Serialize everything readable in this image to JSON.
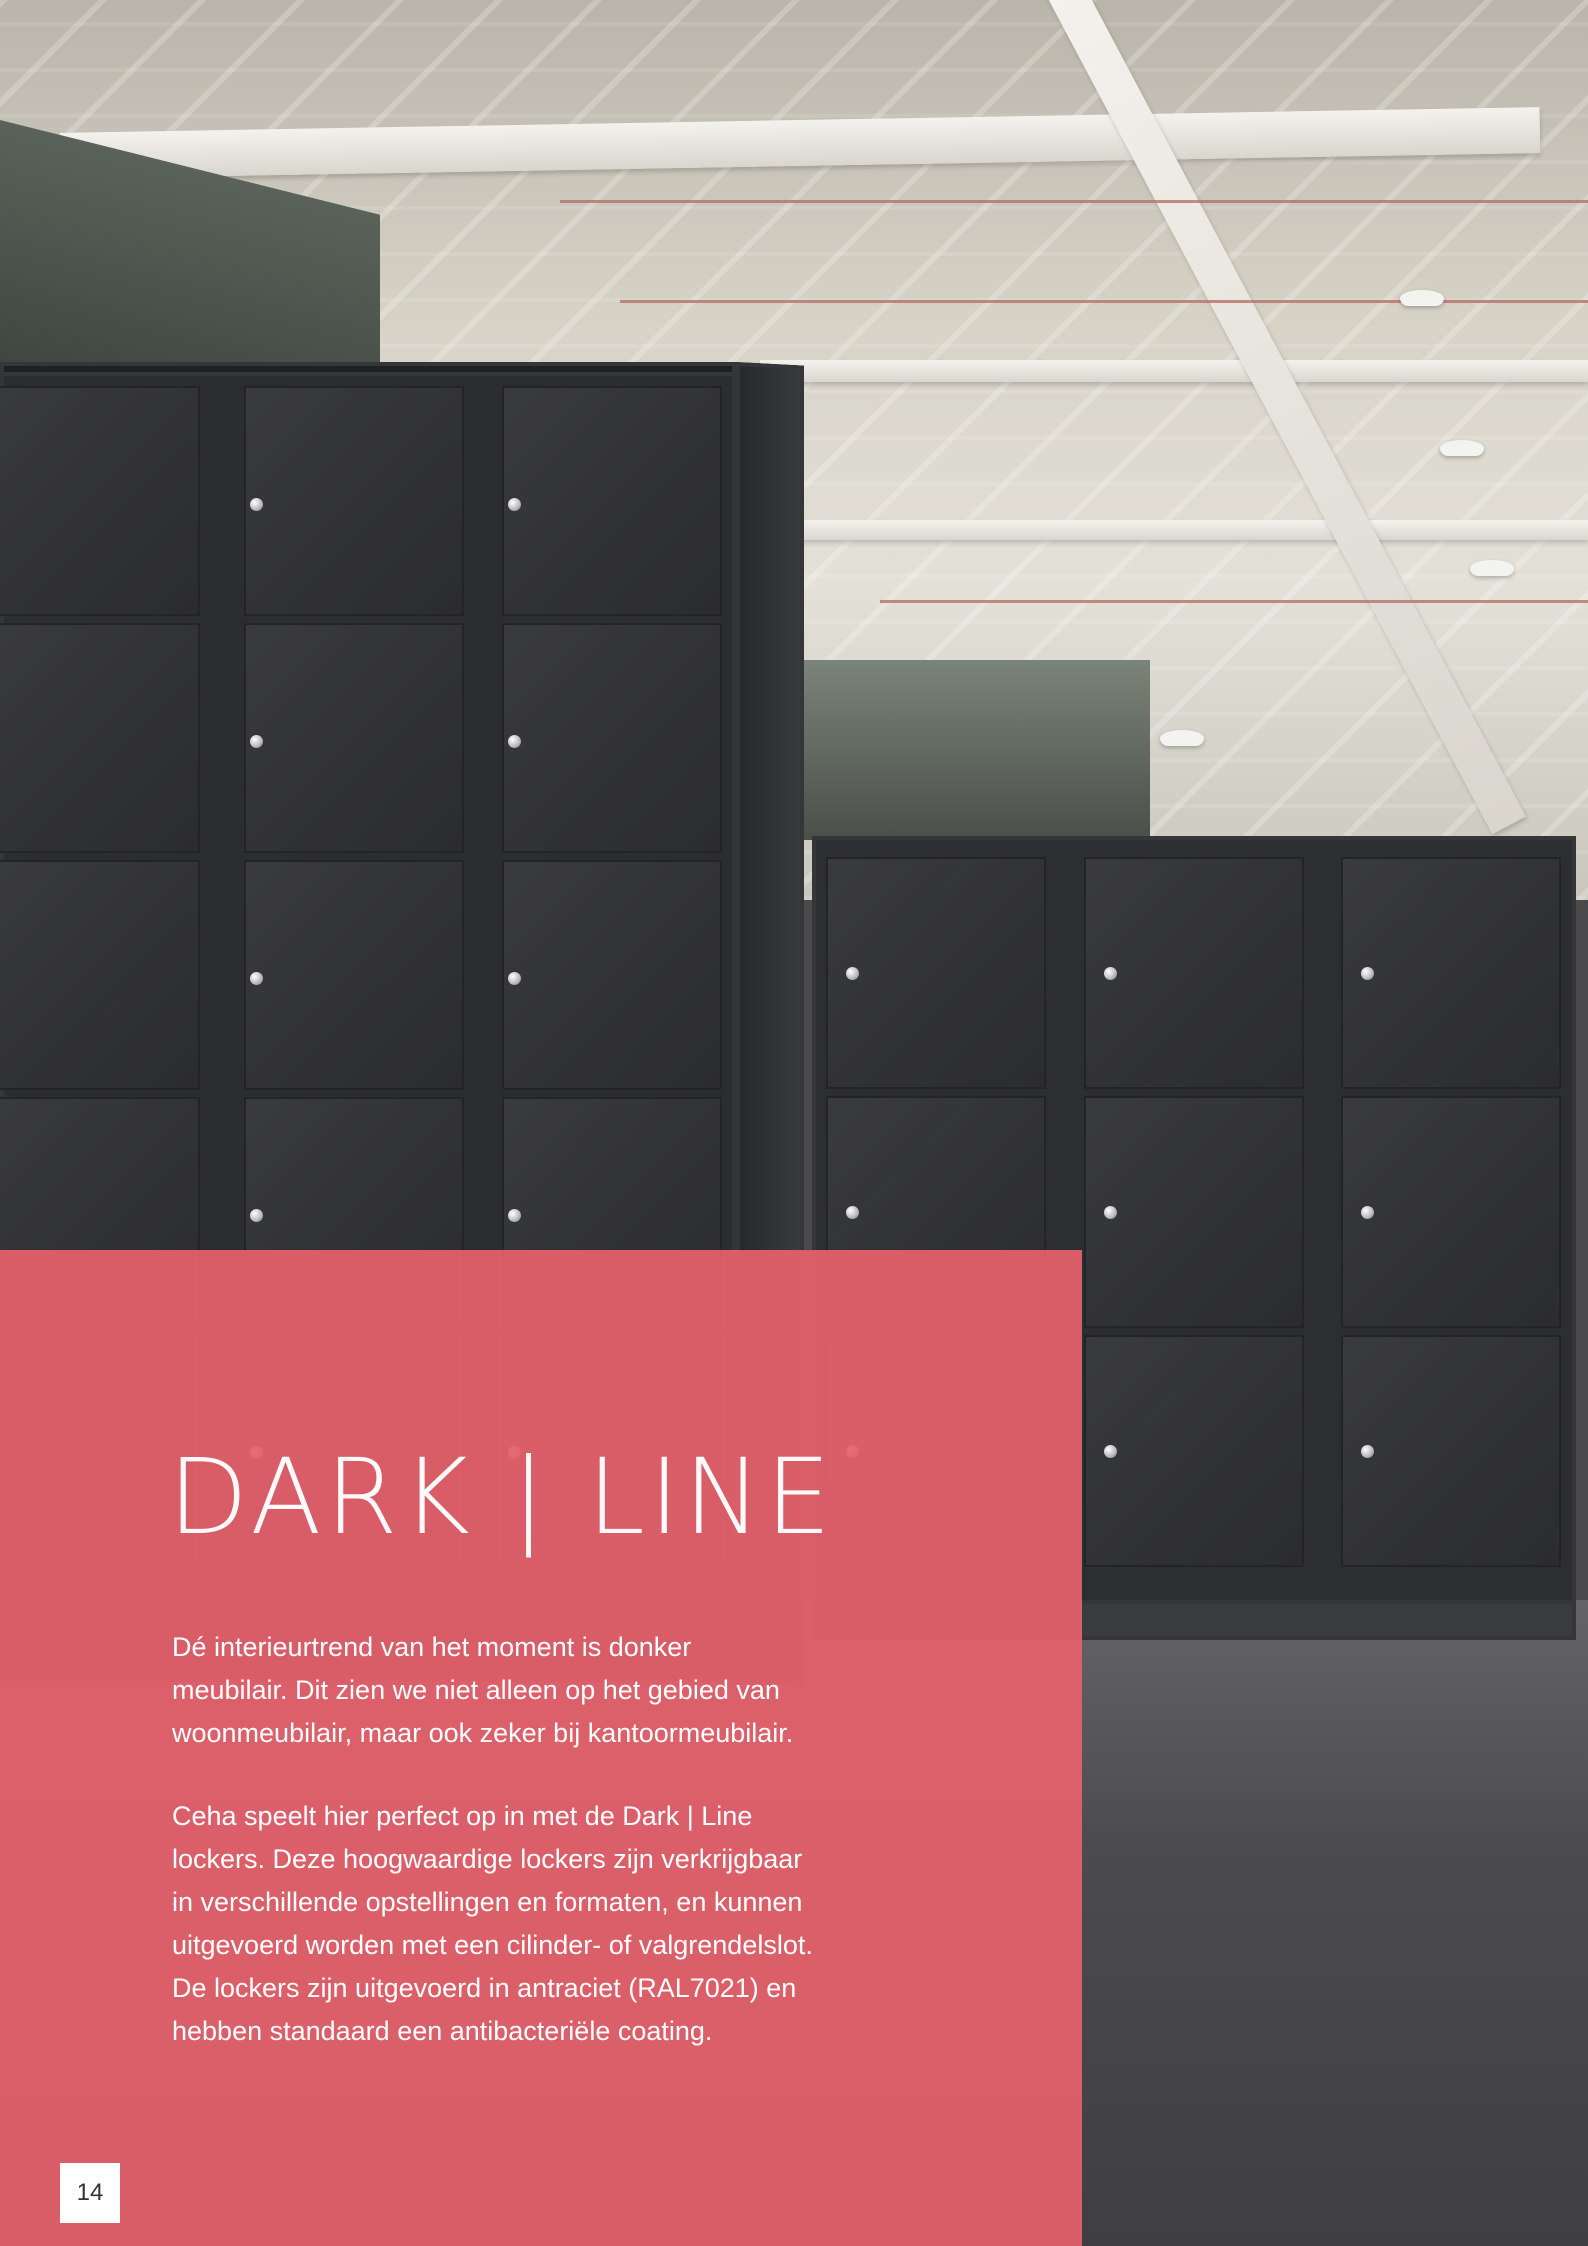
{
  "page": {
    "title": "DARK | LINE",
    "paragraphs": [
      "Dé interieurtrend van het moment is donker\nmeubilair. Dit zien we niet alleen op het gebied van\nwoonmeubilair, maar ook zeker bij kantoormeubilair.",
      "Ceha speelt hier perfect op in met de Dark | Line\nlockers. Deze hoogwaardige lockers zijn verkrijgbaar\nin verschillende opstellingen en formaten, en kunnen\nuitgevoerd worden met een cilinder- of valgrendelslot.\nDe lockers zijn uitgevoerd in antraciet (RAL7021) en\nhebben standaard een antibacteriële coating."
    ],
    "page_number": "14"
  },
  "colors": {
    "panel": "#e6616c",
    "text": "#ffffff",
    "locker": "#2f3033"
  }
}
